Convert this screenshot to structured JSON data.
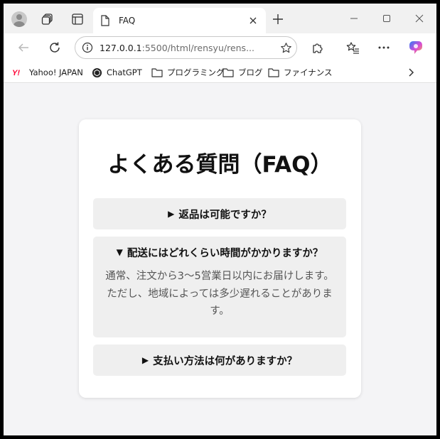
{
  "browser": {
    "tab": {
      "title": "FAQ"
    },
    "url": {
      "host": "127.0.0.1",
      "rest": ":5500/html/rensyu/rens..."
    },
    "bookmarks": [
      {
        "label": "Yahoo! JAPAN",
        "icon": "yahoo-icon"
      },
      {
        "label": "ChatGPT",
        "icon": "chatgpt-icon"
      },
      {
        "label": "プログラミング",
        "icon": "folder-icon"
      },
      {
        "label": "ブログ",
        "icon": "folder-icon"
      },
      {
        "label": "ファイナンス",
        "icon": "folder-icon"
      }
    ]
  },
  "page": {
    "title": "よくある質問（FAQ）",
    "faqs": [
      {
        "marker": "▶",
        "question": "返品は可能ですか？",
        "expanded": false
      },
      {
        "marker": "▼",
        "question": "配送にはどれくらい時間がかかりますか？",
        "expanded": true,
        "answer": "通常、注文から3〜5営業日以内にお届けします。ただし、地域によっては多少遅れることがあります。"
      },
      {
        "marker": "▶",
        "question": "支払い方法は何がありますか？",
        "expanded": false
      }
    ]
  },
  "colors": {
    "yahoo_red": "#ff0033",
    "copilot_gradient": [
      "#2f7bf5",
      "#d94bd6",
      "#f7b733"
    ]
  }
}
